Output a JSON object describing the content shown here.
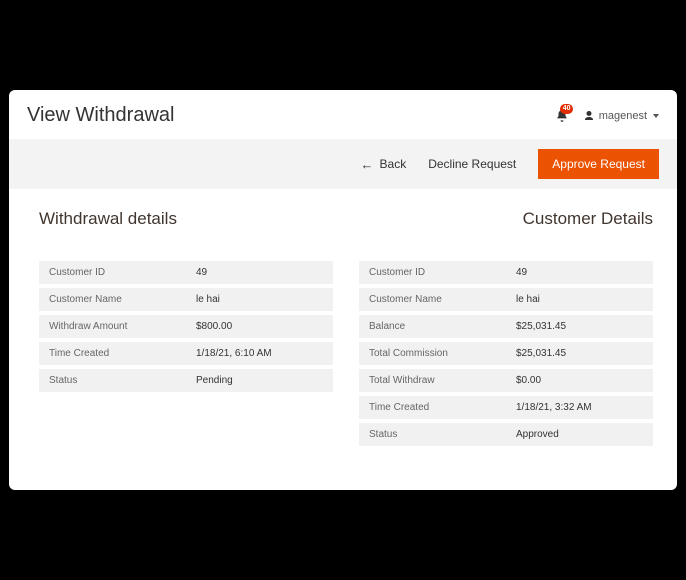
{
  "header": {
    "title": "View Withdrawal",
    "notification_count": "40",
    "user_name": "magenest"
  },
  "actionbar": {
    "back_label": "Back",
    "decline_label": "Decline Request",
    "approve_label": "Approve Request"
  },
  "withdrawal": {
    "title": "Withdrawal details",
    "rows": [
      {
        "label": "Customer ID",
        "value": "49"
      },
      {
        "label": "Customer Name",
        "value": "le hai"
      },
      {
        "label": "Withdraw Amount",
        "value": "$800.00"
      },
      {
        "label": "Time Created",
        "value": "1/18/21, 6:10 AM"
      },
      {
        "label": "Status",
        "value": "Pending"
      }
    ]
  },
  "customer": {
    "title": "Customer Details",
    "rows": [
      {
        "label": "Customer ID",
        "value": "49"
      },
      {
        "label": "Customer Name",
        "value": "le hai"
      },
      {
        "label": "Balance",
        "value": "$25,031.45"
      },
      {
        "label": "Total Commission",
        "value": "$25,031.45"
      },
      {
        "label": "Total Withdraw",
        "value": "$0.00"
      },
      {
        "label": "Time Created",
        "value": "1/18/21, 3:32 AM"
      },
      {
        "label": "Status",
        "value": "Approved"
      }
    ]
  }
}
